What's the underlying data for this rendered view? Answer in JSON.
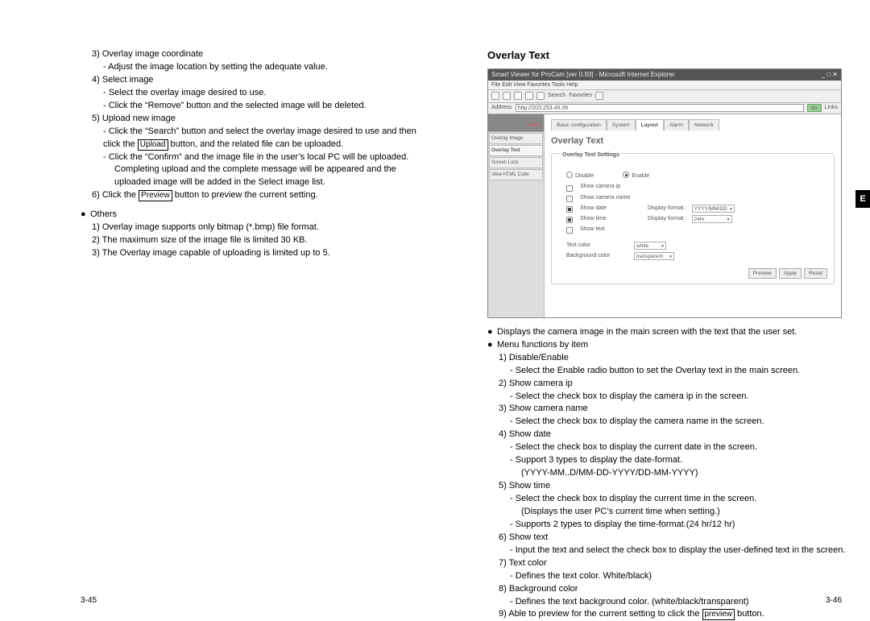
{
  "sideTab": "E",
  "pageLeft": "3-45",
  "pageRight": "3-46",
  "left": {
    "l3": "3) Overlay image coordinate",
    "l3a": "- Adjust the image location by setting the adequate value.",
    "l4": "4) Select image",
    "l4a": "- Select the overlay image desired to use.",
    "l4b": "- Click the “Remove” button and the selected image will be deleted.",
    "l5": "5) Upload new image",
    "l5a_pre": "- Click the “Search” button and select the overlay image desired to use and then click the ",
    "l5a_btn": "Upload",
    "l5a_post": " button, and the related file can be uploaded.",
    "l5b": "- Click the “Confirm” and the image file in the user’s local PC will be uploaded.",
    "l5c": "Completing upload and the complete message will be appeared and the uploaded image will be added in the Select image list.",
    "l6_pre": "6) Click the ",
    "l6_btn": "Preview",
    "l6_post": " button to preview the current setting.",
    "others": "Others",
    "o1": "1) Overlay image supports only bitmap (*.bmp) file format.",
    "o2": "2) The maximum size of the image file is limited 30 KB.",
    "o3": "3) The Overlay image capable of uploading is limited up to 5."
  },
  "right": {
    "title": "Overlay Text",
    "b1": "Displays the camera image in the main screen with the text that the user set.",
    "b2": "Menu functions by item",
    "i1": "1) Disable/Enable",
    "i1a": "- Select the Enable radio button to set the Overlay text in the main screen.",
    "i2": "2) Show camera ip",
    "i2a": "- Select the check box to display the camera ip in the screen.",
    "i3": "3) Show camera name",
    "i3a": "- Select the check box to display the camera name in the screen.",
    "i4": "4) Show date",
    "i4a": "- Select the check box to display the current date in the screen.",
    "i4b": "- Support 3 types to display the date-format.",
    "i4c": "(YYYY-MM..D/MM-DD-YYYY/DD-MM-YYYY)",
    "i5": "5) Show time",
    "i5a": "- Select the check box to display the current time in the screen.",
    "i5b": "(Displays the user PC’s current time when setting.)",
    "i5c": "- Supports 2 types to display the time-format.(24 hr/12 hr)",
    "i6": "6) Show text",
    "i6a": "- Input the text and select the check box to display the user-defined text in the screen.",
    "i7": "7) Text color",
    "i7a": "- Defines the text color. White/black)",
    "i8": "8) Background color",
    "i8a": "- Defines the text background color. (white/black/transparent)",
    "i9_pre": "9) Able to preview for the current setting to click the ",
    "i9_btn": "preview",
    "i9_post": " button."
  },
  "shot": {
    "title": "Smart Viewer for ProCam [ver 0.93] - Microsoft Internet Explorer",
    "menu": "File  Edit  View  Favorites  Tools  Help",
    "addrLabel": "Address",
    "addr": "http://203.253.49.39",
    "go": "Go",
    "links": "Links",
    "camRec": "● REC",
    "side1": "Overlay Image",
    "side2": "Overlay Text",
    "side3": "Screen Lock",
    "side4": "View HTML Code",
    "tab1": "Basic configuration",
    "tab2": "System",
    "tab3": "Layout",
    "tab4": "Alarm",
    "tab5": "Network",
    "mainTitle": "Overlay Text",
    "legend": "Overlay Text Settings",
    "rDisable": "Disable",
    "rEnable": "Enable",
    "c1": "Show camera ip",
    "c2": "Show camera name",
    "c3": "Show date",
    "c3l": "Display format :",
    "c3v": "YYYY/MM/DD",
    "c4": "Show time",
    "c4l": "Display format :",
    "c4v": "24hr",
    "c5": "Show text",
    "tc": "Text color",
    "tcv": "white",
    "bg": "Background color",
    "bgv": "transparent",
    "bPrev": "Preview",
    "bApply": "Apply",
    "bReset": "Reset"
  }
}
